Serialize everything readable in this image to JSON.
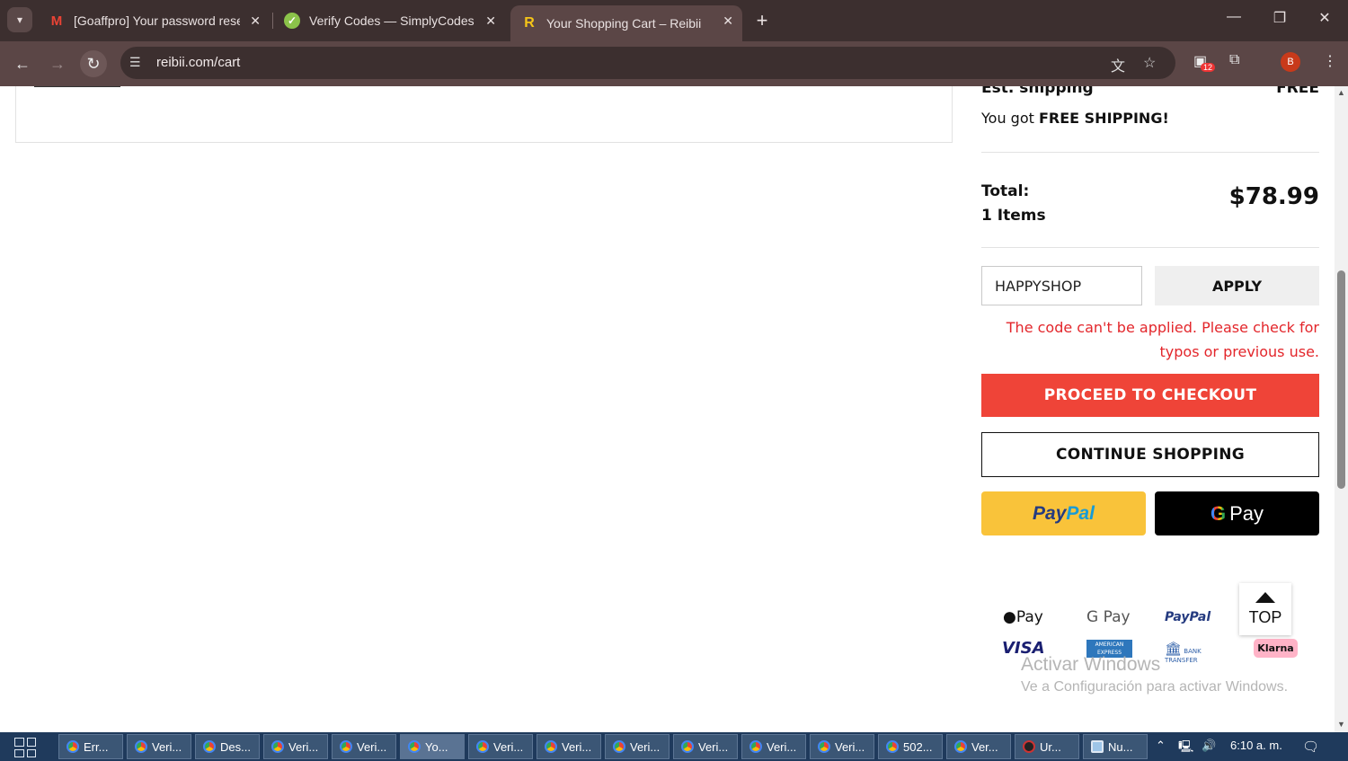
{
  "browser": {
    "tabs": [
      {
        "title": "[Goaffpro] Your password reset",
        "favicon": "gmail-icon"
      },
      {
        "title": "Verify Codes — SimplyCodes",
        "favicon": "simplycodes-icon"
      },
      {
        "title": "Your Shopping Cart – Reibii",
        "favicon": "reibii-icon",
        "favicon_letter": "R"
      }
    ],
    "url": "reibii.com/cart",
    "extensions_badge": "12",
    "profile_initial": "B"
  },
  "summary": {
    "shipping_label": "Est. shipping",
    "shipping_value": "FREE",
    "free_prefix": "You got ",
    "free_bold": "FREE SHIPPING!",
    "total_label": "Total:",
    "items_label": "1 Items",
    "total_value": "$78.99",
    "coupon_value": "HAPPYSHOP",
    "apply_label": "APPLY",
    "error_message": "The code can't be applied. Please check for typos or previous use.",
    "checkout_label": "PROCEED TO CHECKOUT",
    "continue_label": "CONTINUE SHOPPING",
    "paypal_a": "Pay",
    "paypal_b": "Pal",
    "gpay_g": "G",
    "gpay_text": "Pay"
  },
  "payment_logos": {
    "applepay": "Pay",
    "googlepay": "G Pay",
    "paypal": "PayPal",
    "visa": "VISA",
    "amex": "AMERICAN EXPRESS",
    "bank": "BANK TRANSFER",
    "klarna": "Klarna"
  },
  "top_button": "TOP",
  "watermark": {
    "line1": "Activar Windows",
    "line2": "Ve a Configuración para activar Windows."
  },
  "taskbar": {
    "items": [
      "Err...",
      "Veri...",
      "Des...",
      "Veri...",
      "Veri...",
      "Yo...",
      "Veri...",
      "Veri...",
      "Veri...",
      "Veri...",
      "Veri...",
      "Veri...",
      "502...",
      "Ver...",
      "Ur...",
      "Nu..."
    ],
    "clock": "6:10 a. m."
  }
}
